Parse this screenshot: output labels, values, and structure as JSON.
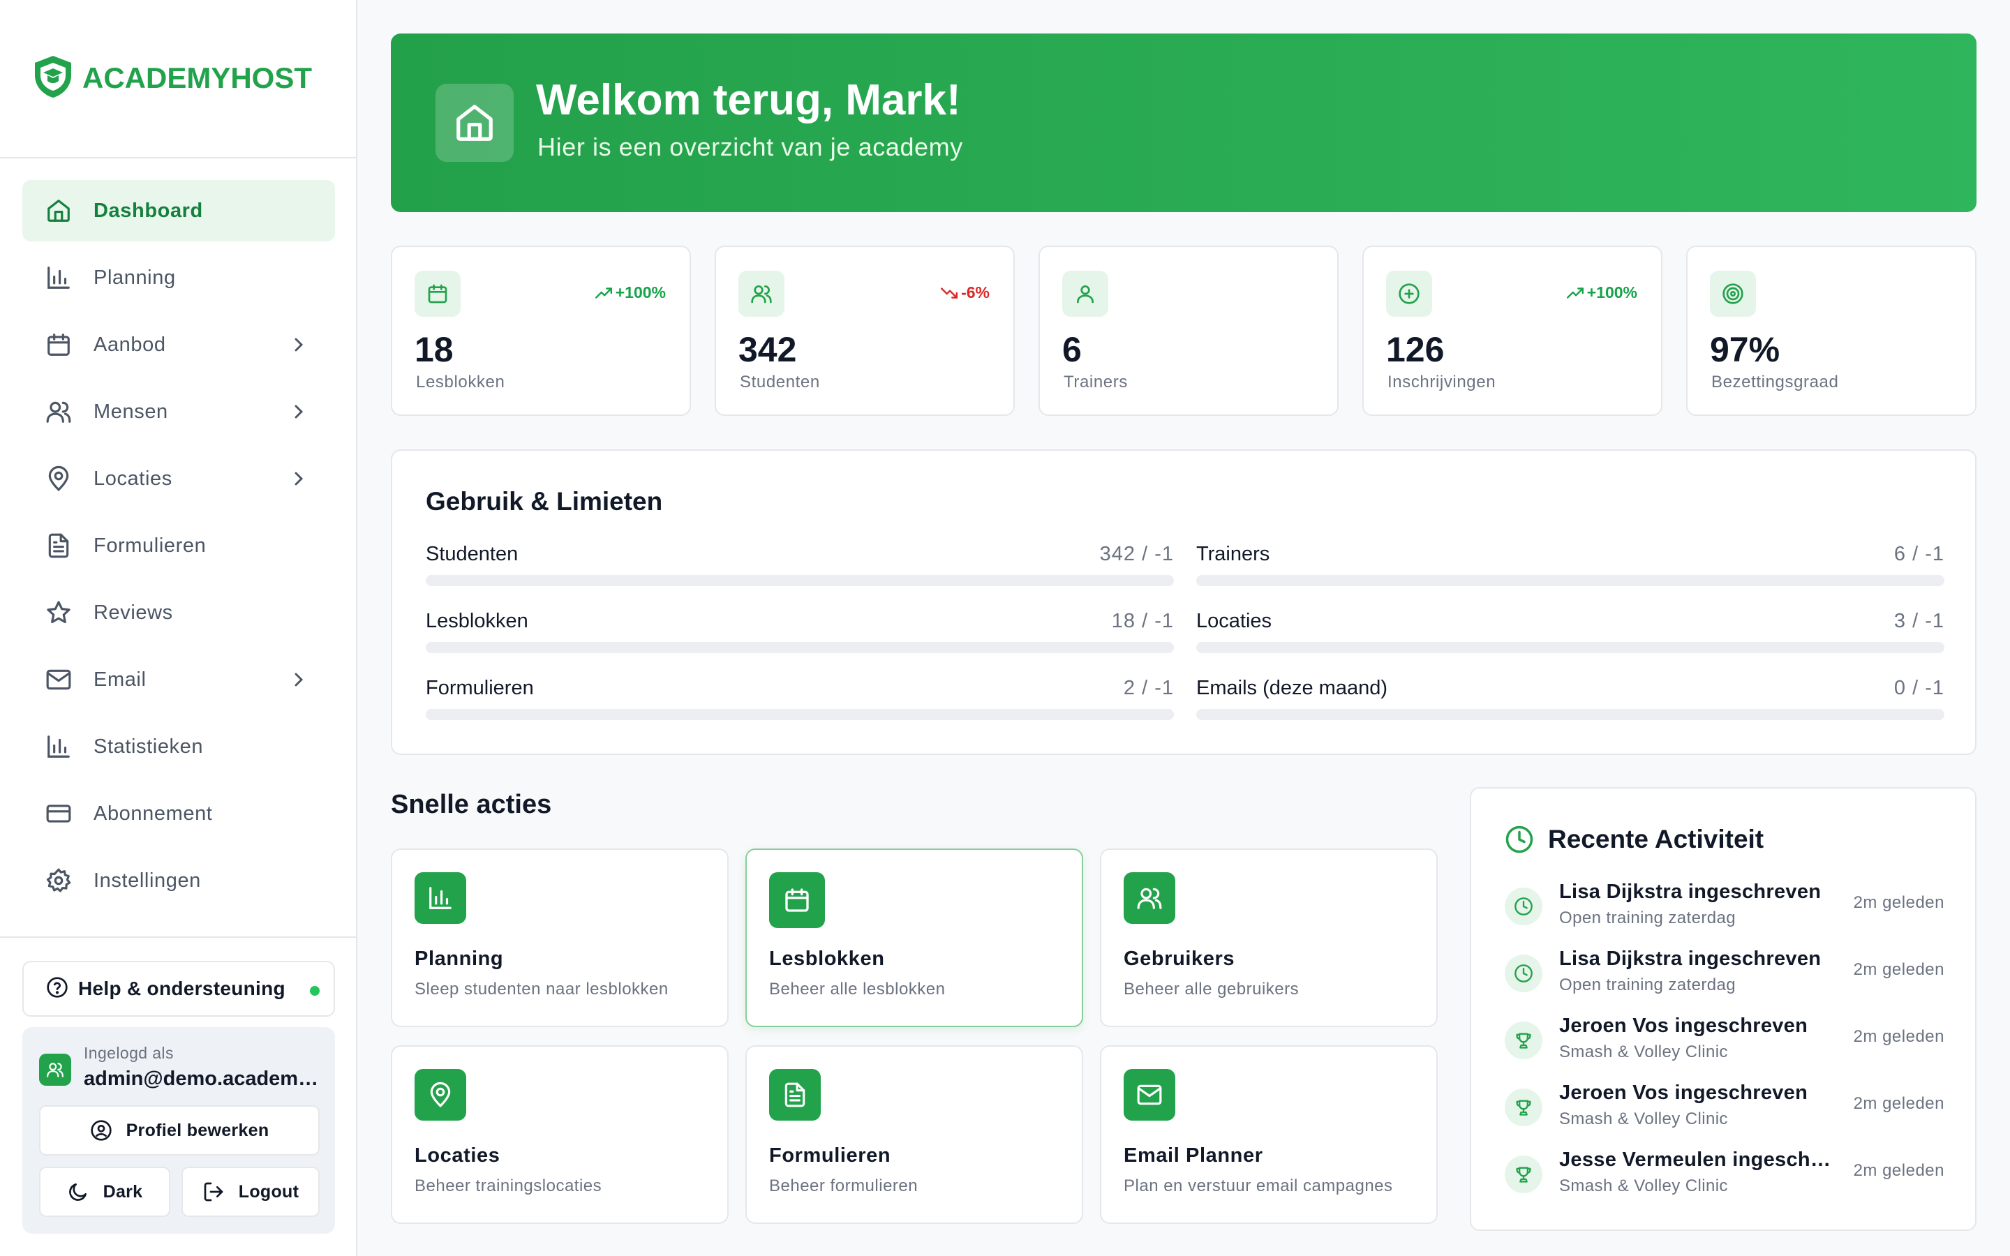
{
  "brand": {
    "name": "ACADEMYHOST",
    "color": "#22a24a"
  },
  "sidebar": {
    "items": [
      {
        "label": "Dashboard",
        "icon": "home-icon",
        "active": true,
        "has_submenu": false
      },
      {
        "label": "Planning",
        "icon": "bar-chart-icon",
        "active": false,
        "has_submenu": false
      },
      {
        "label": "Aanbod",
        "icon": "calendar-icon",
        "active": false,
        "has_submenu": true
      },
      {
        "label": "Mensen",
        "icon": "users-icon",
        "active": false,
        "has_submenu": true
      },
      {
        "label": "Locaties",
        "icon": "map-pin-icon",
        "active": false,
        "has_submenu": true
      },
      {
        "label": "Formulieren",
        "icon": "file-text-icon",
        "active": false,
        "has_submenu": false
      },
      {
        "label": "Reviews",
        "icon": "star-icon",
        "active": false,
        "has_submenu": false
      },
      {
        "label": "Email",
        "icon": "mail-icon",
        "active": false,
        "has_submenu": true
      },
      {
        "label": "Statistieken",
        "icon": "bar-chart-icon",
        "active": false,
        "has_submenu": false
      },
      {
        "label": "Abonnement",
        "icon": "credit-card-icon",
        "active": false,
        "has_submenu": false
      },
      {
        "label": "Instellingen",
        "icon": "gear-icon",
        "active": false,
        "has_submenu": false
      }
    ],
    "help": {
      "label": "Help & ondersteuning",
      "status": "online"
    },
    "user": {
      "caption": "Ingelogd als",
      "email": "admin@demo.academyhost.nl",
      "edit_profile": "Profiel bewerken",
      "dark": "Dark",
      "logout": "Logout"
    }
  },
  "hero": {
    "title": "Welkom terug, Mark!",
    "subtitle": "Hier is een overzicht van je academy"
  },
  "stats": [
    {
      "value": "18",
      "label": "Lesblokken",
      "trend": "+100%",
      "direction": "up",
      "icon": "calendar-icon"
    },
    {
      "value": "342",
      "label": "Studenten",
      "trend": "-6%",
      "direction": "down",
      "icon": "users-icon"
    },
    {
      "value": "6",
      "label": "Trainers",
      "trend": "",
      "direction": "none",
      "icon": "user-icon"
    },
    {
      "value": "126",
      "label": "Inschrijvingen",
      "trend": "+100%",
      "direction": "up",
      "icon": "plus-circle-icon"
    },
    {
      "value": "97%",
      "label": "Bezettingsgraad",
      "trend": "",
      "direction": "none",
      "icon": "target-icon"
    }
  ],
  "usage": {
    "title": "Gebruik & Limieten",
    "rows": [
      {
        "name": "Studenten",
        "value": "342 / -1",
        "fill_percent": 0
      },
      {
        "name": "Trainers",
        "value": "6 / -1",
        "fill_percent": 0
      },
      {
        "name": "Lesblokken",
        "value": "18 / -1",
        "fill_percent": 0
      },
      {
        "name": "Locaties",
        "value": "3 / -1",
        "fill_percent": 0
      },
      {
        "name": "Formulieren",
        "value": "2 / -1",
        "fill_percent": 0
      },
      {
        "name": "Emails (deze maand)",
        "value": "0 / -1",
        "fill_percent": 0
      }
    ]
  },
  "quick_actions": {
    "title": "Snelle acties",
    "items": [
      {
        "title": "Planning",
        "desc": "Sleep studenten naar lesblokken",
        "icon": "bar-chart-icon"
      },
      {
        "title": "Lesblokken",
        "desc": "Beheer alle lesblokken",
        "icon": "calendar-icon",
        "highlight": true
      },
      {
        "title": "Gebruikers",
        "desc": "Beheer alle gebruikers",
        "icon": "users-icon"
      },
      {
        "title": "Locaties",
        "desc": "Beheer trainingslocaties",
        "icon": "map-pin-icon"
      },
      {
        "title": "Formulieren",
        "desc": "Beheer formulieren",
        "icon": "file-text-icon"
      },
      {
        "title": "Email Planner",
        "desc": "Plan en verstuur email campagnes",
        "icon": "mail-icon"
      }
    ]
  },
  "activity": {
    "title": "Recente Activiteit",
    "items": [
      {
        "name": "Lisa Dijkstra ingeschreven",
        "sub": "Open training zaterdag",
        "time": "2m geleden",
        "icon": "clock-icon"
      },
      {
        "name": "Lisa Dijkstra ingeschreven",
        "sub": "Open training zaterdag",
        "time": "2m geleden",
        "icon": "clock-icon"
      },
      {
        "name": "Jeroen Vos ingeschreven",
        "sub": "Smash & Volley Clinic",
        "time": "2m geleden",
        "icon": "trophy-icon"
      },
      {
        "name": "Jeroen Vos ingeschreven",
        "sub": "Smash & Volley Clinic",
        "time": "2m geleden",
        "icon": "trophy-icon"
      },
      {
        "name": "Jesse Vermeulen ingeschreven",
        "sub": "Smash & Volley Clinic",
        "time": "2m geleden",
        "icon": "trophy-icon"
      }
    ]
  }
}
